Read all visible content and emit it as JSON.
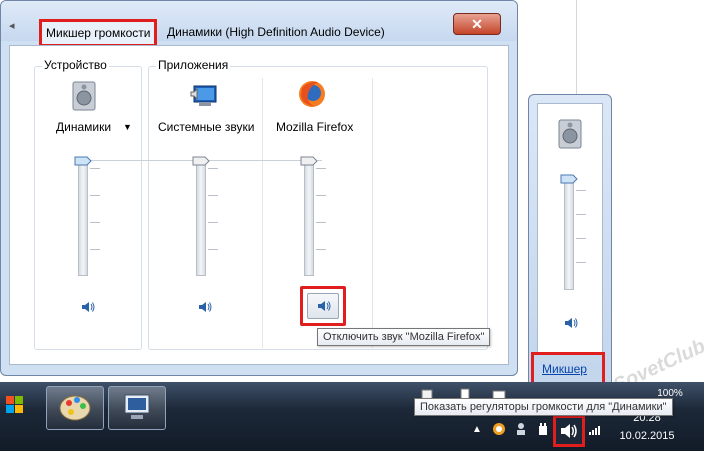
{
  "window": {
    "tab_active": "Микшер громкости",
    "tab_device": "Динамики (High Definition Audio Device)",
    "close_glyph": "✕"
  },
  "groups": {
    "device_label": "Устройство",
    "apps_label": "Приложения"
  },
  "columns": [
    {
      "label": "Динамики",
      "icon": "speaker-device-icon",
      "dropdown": true,
      "level": 1.0
    },
    {
      "label": "Системные звуки",
      "icon": "system-sounds-icon",
      "dropdown": false,
      "level": 1.0
    },
    {
      "label": "Mozilla Firefox",
      "icon": "firefox-icon",
      "dropdown": false,
      "level": 1.0
    }
  ],
  "tooltips": {
    "mute_firefox": "Отключить звук \"Mozilla Firefox\"",
    "show_controls": "Показать регуляторы громкости для \"Динамики\""
  },
  "tray_popup": {
    "level": 0.95,
    "mixer_link": "Микшер"
  },
  "taskbar": {
    "time": "20:28",
    "date": "10.02.2015",
    "zoom": "100%"
  },
  "watermark": "SovetClub",
  "colors": {
    "highlight": "#e01e1e",
    "link": "#0645ad",
    "taskbar": "#1c2838"
  }
}
